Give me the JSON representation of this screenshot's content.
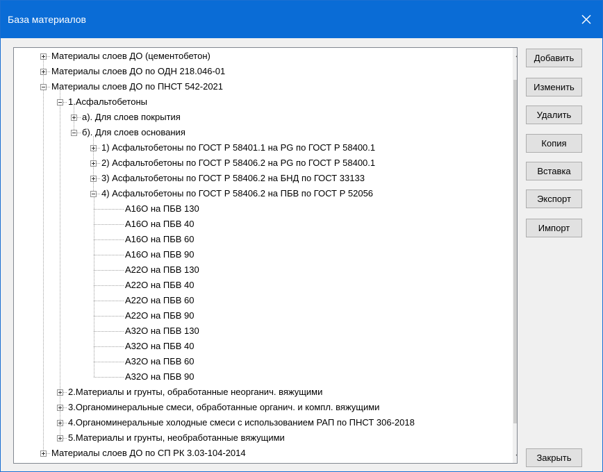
{
  "window": {
    "title": "База материалов"
  },
  "tree": {
    "nodes": [
      {
        "text": "Материалы слоев ДО (цементобетон)",
        "level": 0,
        "expander": "plus"
      },
      {
        "text": "Материалы слоев ДО по ОДН 218.046-01",
        "level": 0,
        "expander": "plus"
      },
      {
        "text": "Материалы слоев ДО по ПНСТ 542-2021",
        "level": 0,
        "expander": "minus"
      },
      {
        "text": "1.Асфальтобетоны",
        "level": 1,
        "expander": "minus"
      },
      {
        "text": "а). Для слоев покрытия",
        "level": 2,
        "expander": "plus"
      },
      {
        "text": "б). Для слоев основания",
        "level": 2,
        "expander": "minus"
      },
      {
        "text": "1) Асфальтобетоны по ГОСТ Р 58401.1 на PG по ГОСТ Р 58400.1",
        "level": 3,
        "expander": "plus"
      },
      {
        "text": "2) Асфальтобетоны по ГОСТ Р 58406.2 на PG по ГОСТ Р 58400.1",
        "level": 3,
        "expander": "plus"
      },
      {
        "text": "3) Асфальтобетоны по ГОСТ Р 58406.2 на БНД по ГОСТ 33133",
        "level": 3,
        "expander": "plus"
      },
      {
        "text": "4) Асфальтобетоны по ГОСТ Р 58406.2 на ПБВ по ГОСТ Р 52056",
        "level": 3,
        "expander": "minus"
      },
      {
        "text": "А16О на ПБВ 130",
        "level": 4,
        "expander": "none"
      },
      {
        "text": "А16О на ПБВ 40",
        "level": 4,
        "expander": "none"
      },
      {
        "text": "А16О на ПБВ 60",
        "level": 4,
        "expander": "none"
      },
      {
        "text": "А16О на ПБВ 90",
        "level": 4,
        "expander": "none"
      },
      {
        "text": "А22О на ПБВ 130",
        "level": 4,
        "expander": "none"
      },
      {
        "text": "А22О на ПБВ 40",
        "level": 4,
        "expander": "none"
      },
      {
        "text": "А22О на ПБВ 60",
        "level": 4,
        "expander": "none"
      },
      {
        "text": "А22О на ПБВ 90",
        "level": 4,
        "expander": "none"
      },
      {
        "text": "А32О на ПБВ 130",
        "level": 4,
        "expander": "none"
      },
      {
        "text": "А32О на ПБВ 40",
        "level": 4,
        "expander": "none"
      },
      {
        "text": "А32О на ПБВ 60",
        "level": 4,
        "expander": "none"
      },
      {
        "text": "А32О на ПБВ 90",
        "level": 4,
        "expander": "none"
      },
      {
        "text": "2.Материалы и грунты, обработанные неорганич. вяжущими",
        "level": 1,
        "expander": "plus"
      },
      {
        "text": "3.Органоминеральные смеси, обработанные органич. и компл. вяжущими",
        "level": 1,
        "expander": "plus"
      },
      {
        "text": "4.Органоминеральные холодные смеси с использованием РАП по ПНСТ 306-2018",
        "level": 1,
        "expander": "plus"
      },
      {
        "text": "5.Материалы и грунты, необработанные вяжущими",
        "level": 1,
        "expander": "plus"
      },
      {
        "text": "Материалы слоев ДО по СП РК 3.03-104-2014",
        "level": 0,
        "expander": "plus"
      }
    ]
  },
  "buttons": {
    "add": "Добавить",
    "edit": "Изменить",
    "delete": "Удалить",
    "copy": "Копия",
    "paste": "Вставка",
    "export": "Экспорт",
    "import": "Импорт",
    "close": "Закрыть"
  },
  "colors": {
    "titlebar": "#0a6cd6",
    "window_bg": "#f0f0f0",
    "tree_bg": "#ffffff"
  },
  "icons": {
    "close": "close-x-icon",
    "scroll_up": "chevron-up-icon",
    "scroll_down": "chevron-down-icon"
  }
}
